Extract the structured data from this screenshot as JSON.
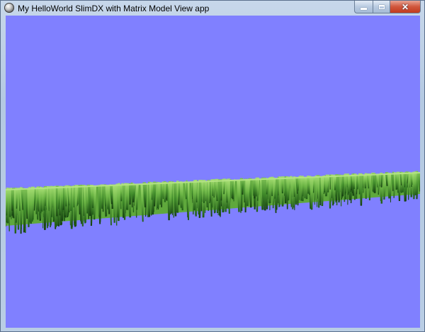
{
  "window": {
    "title": "My HelloWorld SlimDX with Matrix Model View app",
    "icon": "globe-app-icon",
    "controls": {
      "minimize_icon": "minimize-icon",
      "maximize_icon": "maximize-icon",
      "close_icon": "close-icon",
      "close_glyph": "✕"
    }
  },
  "scene": {
    "background_color": "#8080ff",
    "grass_colors": [
      "#9bd46a",
      "#6cb845",
      "#3f8a2a",
      "#1f5c16"
    ]
  }
}
